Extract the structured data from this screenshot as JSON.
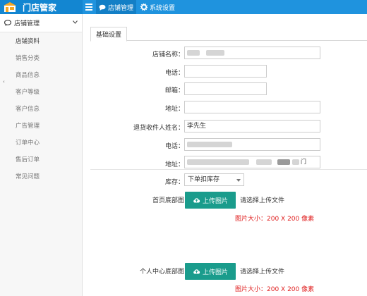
{
  "header": {
    "app_title": "门店管家",
    "nav": [
      {
        "label": "店铺管理"
      },
      {
        "label": "系统设置"
      }
    ]
  },
  "sidebar": {
    "section_title": "店铺管理",
    "items": [
      {
        "label": "店铺资料"
      },
      {
        "label": "销售分类"
      },
      {
        "label": "商品信息"
      },
      {
        "label": "客户等级"
      },
      {
        "label": "客户信息"
      },
      {
        "label": "广告管理"
      },
      {
        "label": "订单中心"
      },
      {
        "label": "售后订单"
      },
      {
        "label": "常见问题"
      }
    ]
  },
  "main": {
    "tab": "基础设置",
    "form": {
      "store_name_label": "店铺名称：",
      "phone_label": "电话：",
      "email_label": "邮箱：",
      "address_label": "地址：",
      "return_name_label": "退货收件人姓名：",
      "return_name_value": "李先生",
      "return_phone_label": "电话：",
      "return_address_label": "地址：",
      "return_address_tail": "门",
      "stock_label": "库存：",
      "stock_value": "下单扣库存",
      "home_footer_label": "首页底部图",
      "profile_footer_label": "个人中心底部图",
      "upload_label": "上传图片",
      "upload_hint": "请选择上传文件",
      "size_note": "图片大小：200 X 200 像素"
    }
  },
  "colors": {
    "header": "#1f93de",
    "upload_button": "#1a9c8c",
    "size_note": "#e02020"
  }
}
